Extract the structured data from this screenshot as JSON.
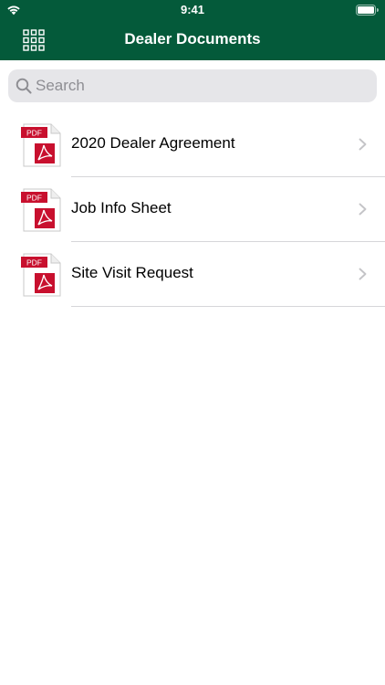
{
  "status_bar": {
    "time": "9:41",
    "wifi_icon": "wifi-icon",
    "battery_icon": "battery-icon"
  },
  "nav_bar": {
    "title": "Dealer Documents",
    "menu_icon": "grid-icon",
    "background_color": "#045a3a"
  },
  "search": {
    "placeholder": "Search",
    "value": "",
    "icon": "search-icon"
  },
  "documents": [
    {
      "title": "2020 Dealer Agreement",
      "icon": "pdf-icon",
      "badge": "PDF"
    },
    {
      "title": "Job Info Sheet",
      "icon": "pdf-icon",
      "badge": "PDF"
    },
    {
      "title": "Site Visit Request",
      "icon": "pdf-icon",
      "badge": "PDF"
    }
  ],
  "colors": {
    "header": "#045a3a",
    "pdf_red": "#c8102e",
    "separator": "#d6d6d9",
    "search_bg": "#e6e6e9"
  }
}
